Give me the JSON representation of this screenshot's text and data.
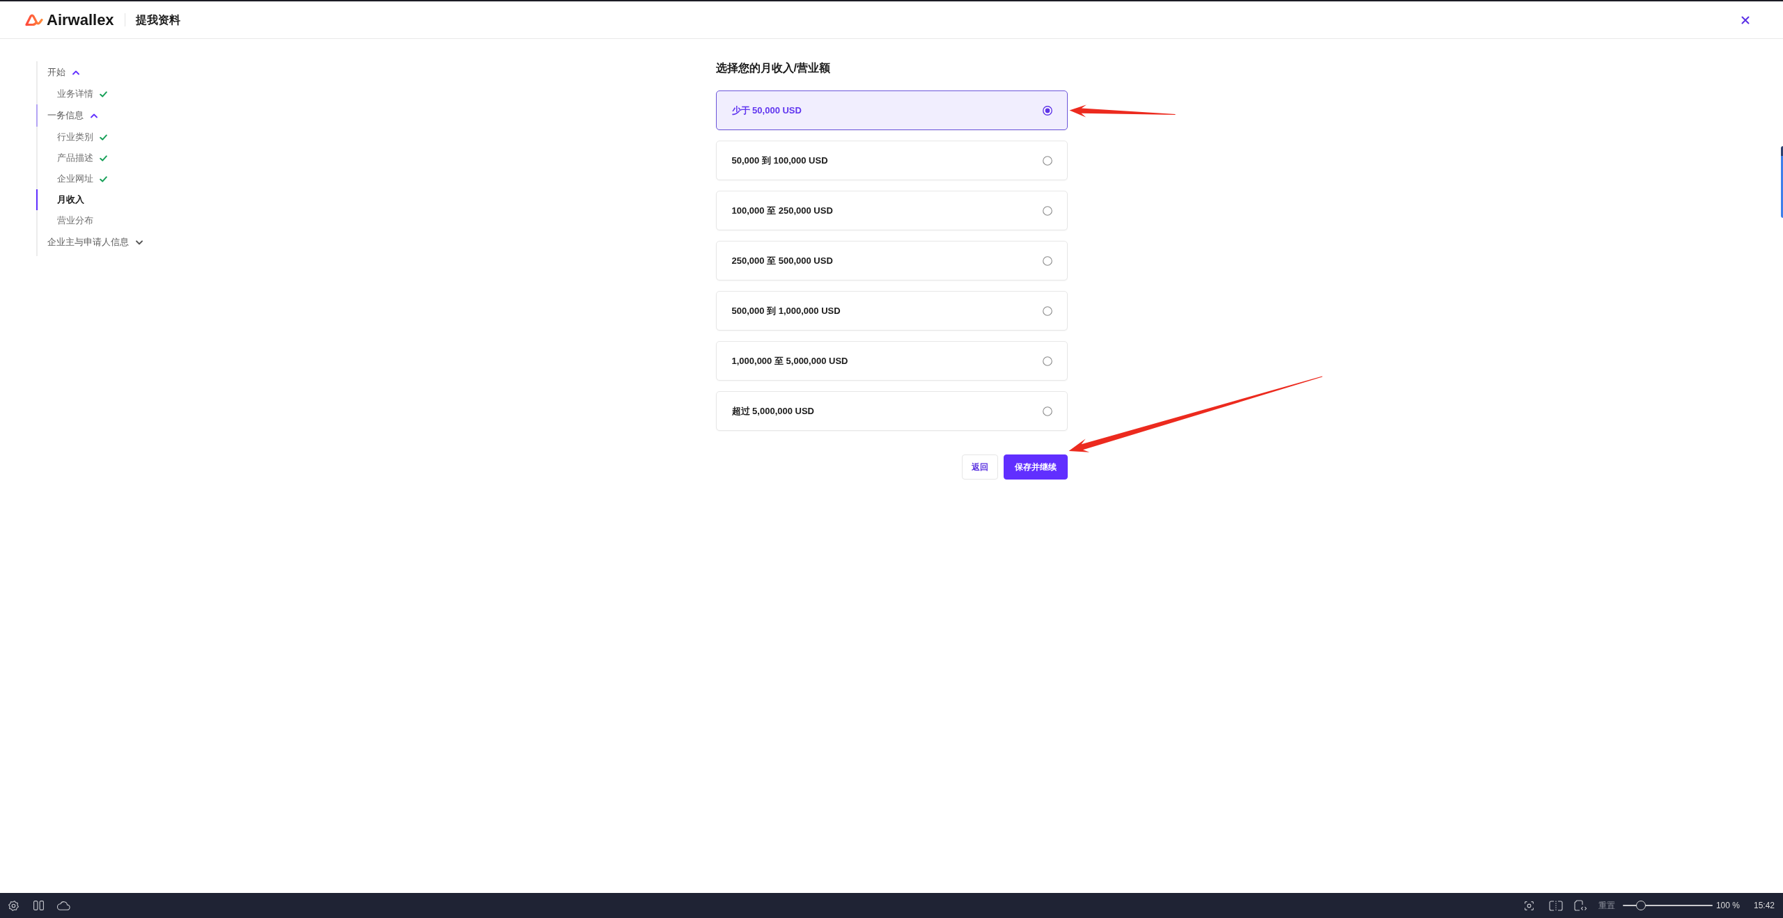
{
  "header": {
    "brand": "Airwallex",
    "title": "提我资料"
  },
  "sidebar": {
    "sections": [
      {
        "label": "开始",
        "expanded": true,
        "active": false,
        "children": [
          {
            "label": "业务详情",
            "done": true,
            "selected": false
          }
        ]
      },
      {
        "label": "一务信息",
        "expanded": true,
        "active": true,
        "children": [
          {
            "label": "行业类别",
            "done": true,
            "selected": false
          },
          {
            "label": "产品描述",
            "done": true,
            "selected": false
          },
          {
            "label": "企业网址",
            "done": true,
            "selected": false
          },
          {
            "label": "月收入",
            "done": false,
            "selected": true
          },
          {
            "label": "营业分布",
            "done": false,
            "selected": false
          }
        ]
      },
      {
        "label": "企业主与申请人信息",
        "expanded": false,
        "active": false
      }
    ]
  },
  "form": {
    "heading": "选择您的月收入/营业额",
    "options": [
      {
        "label": "少于 50,000 USD",
        "selected": true
      },
      {
        "label": "50,000 到 100,000 USD",
        "selected": false
      },
      {
        "label": "100,000 至 250,000 USD",
        "selected": false
      },
      {
        "label": "250,000 至 500,000 USD",
        "selected": false
      },
      {
        "label": "500,000 到 1,000,000 USD",
        "selected": false
      },
      {
        "label": "1,000,000 至 5,000,000 USD",
        "selected": false
      },
      {
        "label": "超过 5,000,000 USD",
        "selected": false
      }
    ],
    "buttons": [
      {
        "label": "返回",
        "kind": "secondary"
      },
      {
        "label": "保存并继续",
        "kind": "primary"
      }
    ]
  },
  "taskbar": {
    "reset": "重置",
    "zoom_slider": {
      "level": 0.2
    },
    "zoom_reading": "100 %",
    "time": "15:42"
  }
}
